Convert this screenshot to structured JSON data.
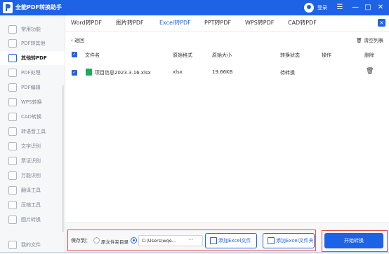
{
  "app": {
    "title": "全能PDF转换助手",
    "login": "登录"
  },
  "sidebar": {
    "items": [
      {
        "label": "常用功能"
      },
      {
        "label": "PDF转其他"
      },
      {
        "label": "其他转PDF",
        "active": true
      },
      {
        "label": "PDF处理"
      },
      {
        "label": "PDF编辑"
      },
      {
        "label": "WPS转换"
      },
      {
        "label": "CAD转换"
      },
      {
        "label": "转语音工具"
      },
      {
        "label": "文字识别"
      },
      {
        "label": "票证识别"
      },
      {
        "label": "万能识别"
      },
      {
        "label": "翻译工具"
      },
      {
        "label": "压缩工具"
      },
      {
        "label": "图片转换"
      }
    ],
    "my_files": "我的文件"
  },
  "tabs": [
    {
      "label": "Word转PDF"
    },
    {
      "label": "图片转PDF"
    },
    {
      "label": "Excel转PDF",
      "active": true
    },
    {
      "label": "PPT转PDF"
    },
    {
      "label": "WPS转PDF"
    },
    {
      "label": "CAD转PDF"
    }
  ],
  "toolbar": {
    "back": "返回",
    "clear": "清空列表"
  },
  "table": {
    "columns": [
      "文件名",
      "原始格式",
      "原始大小",
      "转换状态",
      "操作",
      "删除"
    ],
    "rows": [
      {
        "name": "项目信息2023.3.16.xlsx",
        "format": "xlsx",
        "size": "19.66KB",
        "status": "待转换"
      }
    ]
  },
  "footer": {
    "save_to": "保存到：",
    "option_source": "原文件夹目录",
    "path": "C:\\Users\\wqe...",
    "path_more": "···",
    "add_file": "添加Excel文件",
    "add_folder": "添加Excel文件夹",
    "start": "开始转换"
  },
  "colors": {
    "accent": "#1e63e6",
    "highlight": "#e24b4b"
  }
}
